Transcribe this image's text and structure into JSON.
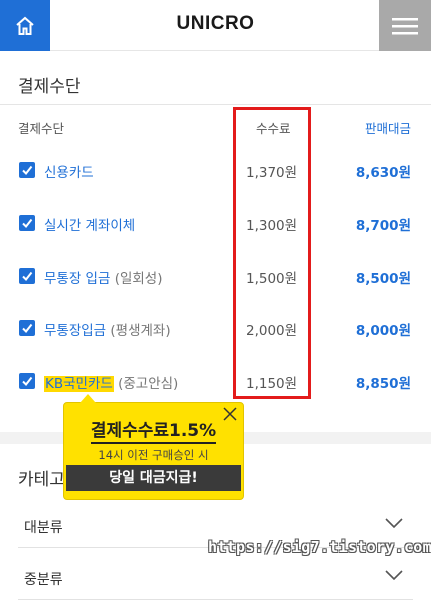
{
  "header": {
    "logo": "UNICRO",
    "home_icon": "home-icon",
    "menu_icon": "hamburger-menu-icon",
    "accent": "#1f6fd6"
  },
  "payment": {
    "title": "결제수단",
    "columns": {
      "method": "결제수단",
      "fee": "수수료",
      "sale": "판매대금"
    },
    "rows": [
      {
        "checked": true,
        "name": "신용카드",
        "sub": "",
        "fee": "1,370원",
        "sale": "8,630원"
      },
      {
        "checked": true,
        "name": "실시간 계좌이체",
        "sub": "",
        "fee": "1,300원",
        "sale": "8,700원"
      },
      {
        "checked": true,
        "name": "무통장 입금",
        "sub": "(일회성)",
        "fee": "1,500원",
        "sale": "8,500원"
      },
      {
        "checked": true,
        "name": "무통장입금",
        "sub": "(평생계좌)",
        "fee": "2,000원",
        "sale": "8,000원"
      },
      {
        "checked": true,
        "name": "KB국민카드",
        "sub": "(중고안심)",
        "fee": "1,150원",
        "sale": "8,850원"
      }
    ]
  },
  "tooltip": {
    "title": "결제수수료1.5%",
    "subtitle": "14시 이전 구매승인 시",
    "banner": "당일 대금지급!",
    "close_icon": "close-icon"
  },
  "category": {
    "title": "카테고리",
    "selects": [
      {
        "label": "대분류"
      },
      {
        "label": "중분류"
      }
    ]
  },
  "watermark": "https://sig7.tistory.com"
}
